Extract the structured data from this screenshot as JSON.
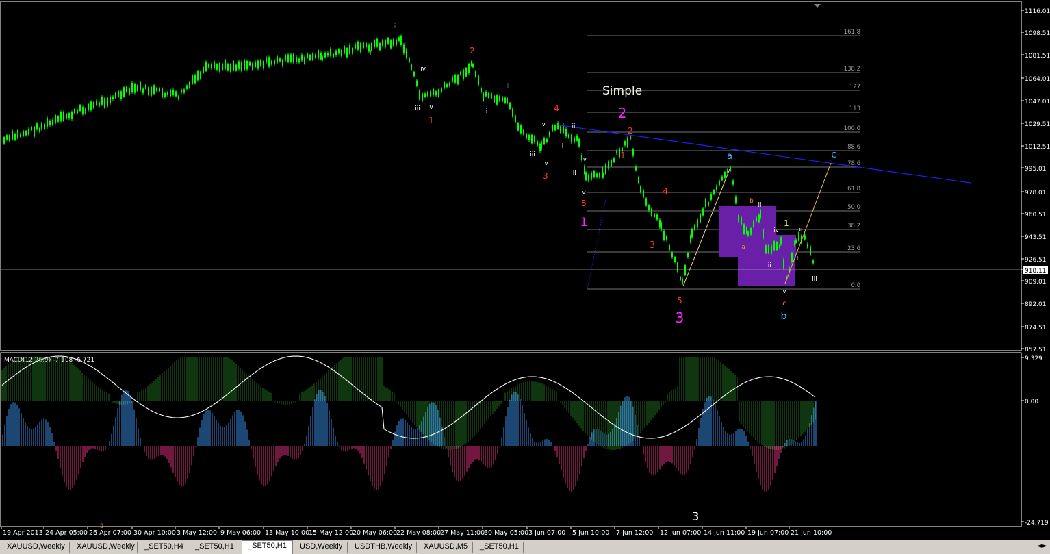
{
  "window": {
    "symbol_timeframe": "_SET50,H1"
  },
  "main_chart": {
    "price_labels": [
      "1116.01",
      "1098.51",
      "1081.51",
      "1064.01",
      "1047.01",
      "1029.51",
      "1012.51",
      "995.01",
      "978.01",
      "960.51",
      "943.51",
      "926.51",
      "918.11",
      "909.01",
      "892.01",
      "874.51",
      "857.51"
    ],
    "current_price": "918.11",
    "time_labels": [
      "19 Apr 2013",
      "24 Apr 05:00",
      "26 Apr 07:00",
      "30 Apr 10:00",
      "3 May 12:00",
      "9 May 06:00",
      "13 May 10:00",
      "15 May 12:00",
      "20 May 06:00",
      "22 May 08:00",
      "27 May 11:00",
      "30 May 05:00",
      "3 Jun 07:00",
      "5 Jun 10:00",
      "7 Jun 12:00",
      "12 Jun 07:00",
      "14 Jun 11:00",
      "19 Jun 07:00",
      "21 Jun 10:00"
    ],
    "fib_levels": [
      "161.8",
      "138.2",
      "127",
      "113",
      "100.0",
      "88.6",
      "78.6",
      "61.8",
      "50.0",
      "38.2",
      "23.6",
      "0.0"
    ],
    "title_text": "Simple",
    "wave_labels": {
      "ii_a": "ii",
      "i_a": "i",
      "iv_a": "iv",
      "iii_a": "iii",
      "v_a": "v",
      "one_red": "1",
      "two_red": "2",
      "ii_b": "ii",
      "i_b": "i",
      "four_red": "4",
      "iv_b": "iv",
      "i_c": "i",
      "ii_c": "ii",
      "iii_b": "iii",
      "v_b": "v",
      "three_red": "3",
      "iv_c": "iv",
      "iii_c": "iii",
      "v_c": "v",
      "five_red": "5",
      "one_mag": "1",
      "two_mag": "2",
      "two_red_b": "2",
      "one_red_b": "1",
      "four_red_b": "4",
      "three_red_b": "3",
      "five_red_b": "5",
      "three_mag": "3",
      "a_cyan": "a",
      "b_orange": "b",
      "ii_d": "ii",
      "a_orange": "a",
      "iv_d": "iv",
      "iii_d": "iii",
      "one_yellow": "1",
      "ii_e": "ii",
      "i_d": "i",
      "iii_e": "iii",
      "v_d": "v",
      "c_orange": "c",
      "b_cyan": "b",
      "c_cyan": "c"
    }
  },
  "macd": {
    "header": "MACD(12,26,9) -7.108 -6.721",
    "scale_labels": [
      "9.329",
      "0.00",
      "-24.719"
    ],
    "label_three": "3",
    "label_two": "2"
  },
  "tabs": [
    "XAUUSD,Weekly",
    "XAUUSD,Weekly",
    "_SET50,H4",
    "_SET50,H1",
    "_SET50,H1",
    "USD,Weekly",
    "USDTHB,Weekly",
    "XAUUSD,M5",
    "_SET50,H1"
  ],
  "active_tab_index": 4,
  "tab_scroll": "◄►",
  "colors": {
    "candle": "#00ff00",
    "trend_line": "#1f1fff",
    "fib": "#9a9a9a",
    "box": "#6a1fa8",
    "macd_hist_pos_green": "#1f6b1f",
    "macd_blue": "#3a8ee6",
    "macd_pink": "#e0307f",
    "wave_red": "#ff3a1a",
    "wave_magenta": "#ff20ff",
    "wave_cyan": "#3ab8ff",
    "wave_orange": "#ff8c1a"
  }
}
